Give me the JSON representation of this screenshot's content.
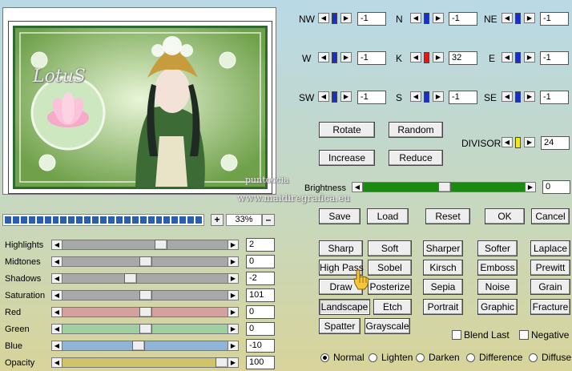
{
  "preview": {
    "title_text": "LotuS",
    "watermark_1": "puntoccia",
    "watermark_2": "www.maidiregrafica.eu"
  },
  "zoom": {
    "plus": "+",
    "minus": "–",
    "value": "33%"
  },
  "adjust": [
    {
      "label": "Highlights",
      "value": "2",
      "level": 0.6,
      "color": "#a8a8a8"
    },
    {
      "label": "Midtones",
      "value": "0",
      "level": 0.5,
      "color": "#a8a8a8"
    },
    {
      "label": "Shadows",
      "value": "-2",
      "level": 0.4,
      "color": "#a8a8a8"
    },
    {
      "label": "Saturation",
      "value": "101",
      "level": 0.5,
      "color": "#a8a8a8"
    },
    {
      "label": "Red",
      "value": "0",
      "level": 0.5,
      "color": "#d4a0a0"
    },
    {
      "label": "Green",
      "value": "0",
      "level": 0.5,
      "color": "#9fd0a0"
    },
    {
      "label": "Blue",
      "value": "-10",
      "level": 0.45,
      "color": "#8fb4d8"
    },
    {
      "label": "Opacity",
      "value": "100",
      "level": 1.0,
      "color": "#cfc46a"
    }
  ],
  "kernel": {
    "nw": {
      "label": "NW",
      "value": "-1"
    },
    "n": {
      "label": "N",
      "value": "-1"
    },
    "ne": {
      "label": "NE",
      "value": "-1"
    },
    "w": {
      "label": "W",
      "value": "-1"
    },
    "k": {
      "label": "K",
      "value": "32"
    },
    "e": {
      "label": "E",
      "value": "-1"
    },
    "sw": {
      "label": "SW",
      "value": "-1"
    },
    "s": {
      "label": "S",
      "value": "-1"
    },
    "se": {
      "label": "SE",
      "value": "-1"
    }
  },
  "actions": {
    "rotate": "Rotate",
    "random": "Random",
    "increase": "Increase",
    "reduce": "Reduce"
  },
  "divisor": {
    "label": "DIVISOR",
    "value": "24"
  },
  "brightness": {
    "label": "Brightness",
    "value": "0",
    "level": 0.5
  },
  "file": {
    "save": "Save",
    "load": "Load",
    "reset": "Reset",
    "ok": "OK",
    "cancel": "Cancel"
  },
  "presets": {
    "sharp": "Sharp",
    "soft": "Soft",
    "sharper": "Sharper",
    "softer": "Softer",
    "laplace": "Laplace",
    "highpass": "High Pass",
    "sobel": "Sobel",
    "kirsch": "Kirsch",
    "emboss": "Emboss",
    "prewitt": "Prewitt",
    "draw": "Draw",
    "posterize": "Posterize",
    "sepia": "Sepia",
    "noise": "Noise",
    "grain": "Grain",
    "landscape": "Landscape",
    "etch": "Etch",
    "portrait": "Portrait",
    "graphic": "Graphic",
    "fracture": "Fracture",
    "spatter": "Spatter",
    "grayscale": "Grayscale"
  },
  "options": {
    "blend_last": "Blend Last",
    "negative": "Negative"
  },
  "modes": {
    "normal": "Normal",
    "lighten": "Lighten",
    "darken": "Darken",
    "difference": "Difference",
    "diffuse": "Diffuse",
    "selected": "normal"
  }
}
